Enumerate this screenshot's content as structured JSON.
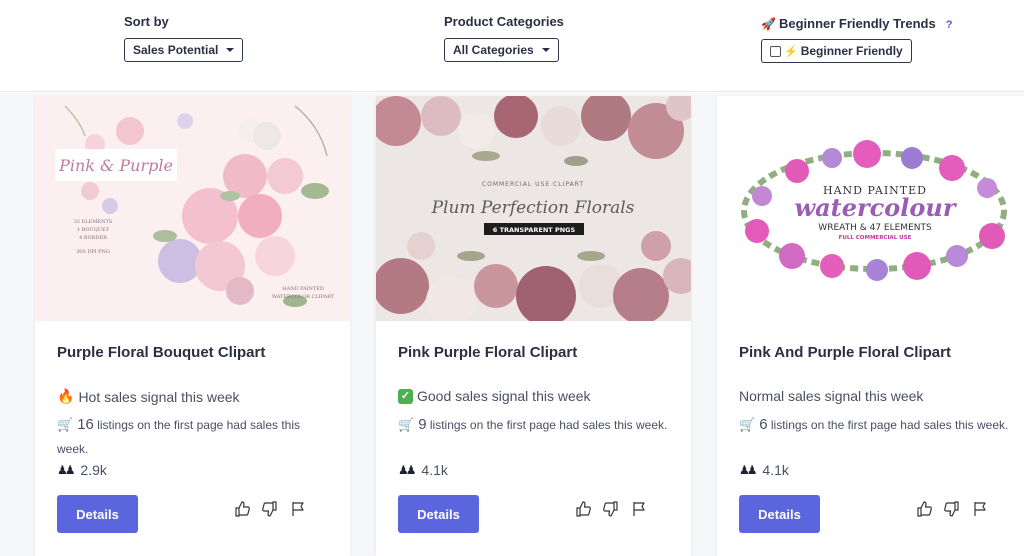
{
  "filters": {
    "sort": {
      "label": "Sort by",
      "value": "Sales Potential"
    },
    "categories": {
      "label": "Product Categories",
      "value": "All Categories"
    },
    "beginner": {
      "label": "Beginner Friendly Trends",
      "help": "?",
      "toggle_label": "Beginner Friendly",
      "checked": false
    }
  },
  "cards": [
    {
      "title": "Purple Floral Bouquet Clipart",
      "signal_icon": "fire-icon",
      "signal": "Hot sales signal this week",
      "listings_count": "16",
      "listings_text": "listings on the first page had sales this week.",
      "views": "2.9k",
      "details_label": "Details",
      "image": {
        "banner": "Pink & Purple",
        "lines": [
          "32 ELEMENTS",
          "1 BOUQUET",
          "4 BORDER",
          "300 DPI PNG"
        ],
        "footer": [
          "HAND PAINTED",
          "WATERCOLOR CLIPART"
        ]
      }
    },
    {
      "title": "Pink Purple Floral Clipart",
      "signal_icon": "check-icon",
      "signal": "Good sales signal this week",
      "listings_count": "9",
      "listings_text": "listings on the first page had sales this week.",
      "views": "4.1k",
      "details_label": "Details",
      "image": {
        "top": "COMMERCIAL USE CLIPART",
        "script": "Plum Perfection Florals",
        "badge": "6 TRANSPARENT PNGS"
      }
    },
    {
      "title": "Pink And Purple Floral Clipart",
      "signal_icon": "",
      "signal": "Normal sales signal this week",
      "listings_count": "6",
      "listings_text": "listings on the first page had sales this week.",
      "views": "4.1k",
      "details_label": "Details",
      "image": {
        "top": "HAND PAINTED",
        "script": "watercolour",
        "line": "WREATH & 47 ELEMENTS",
        "small": "FULL COMMERCIAL USE"
      }
    }
  ],
  "colors": {
    "accent": "#5b65dd",
    "background": "#f6f7f9"
  }
}
